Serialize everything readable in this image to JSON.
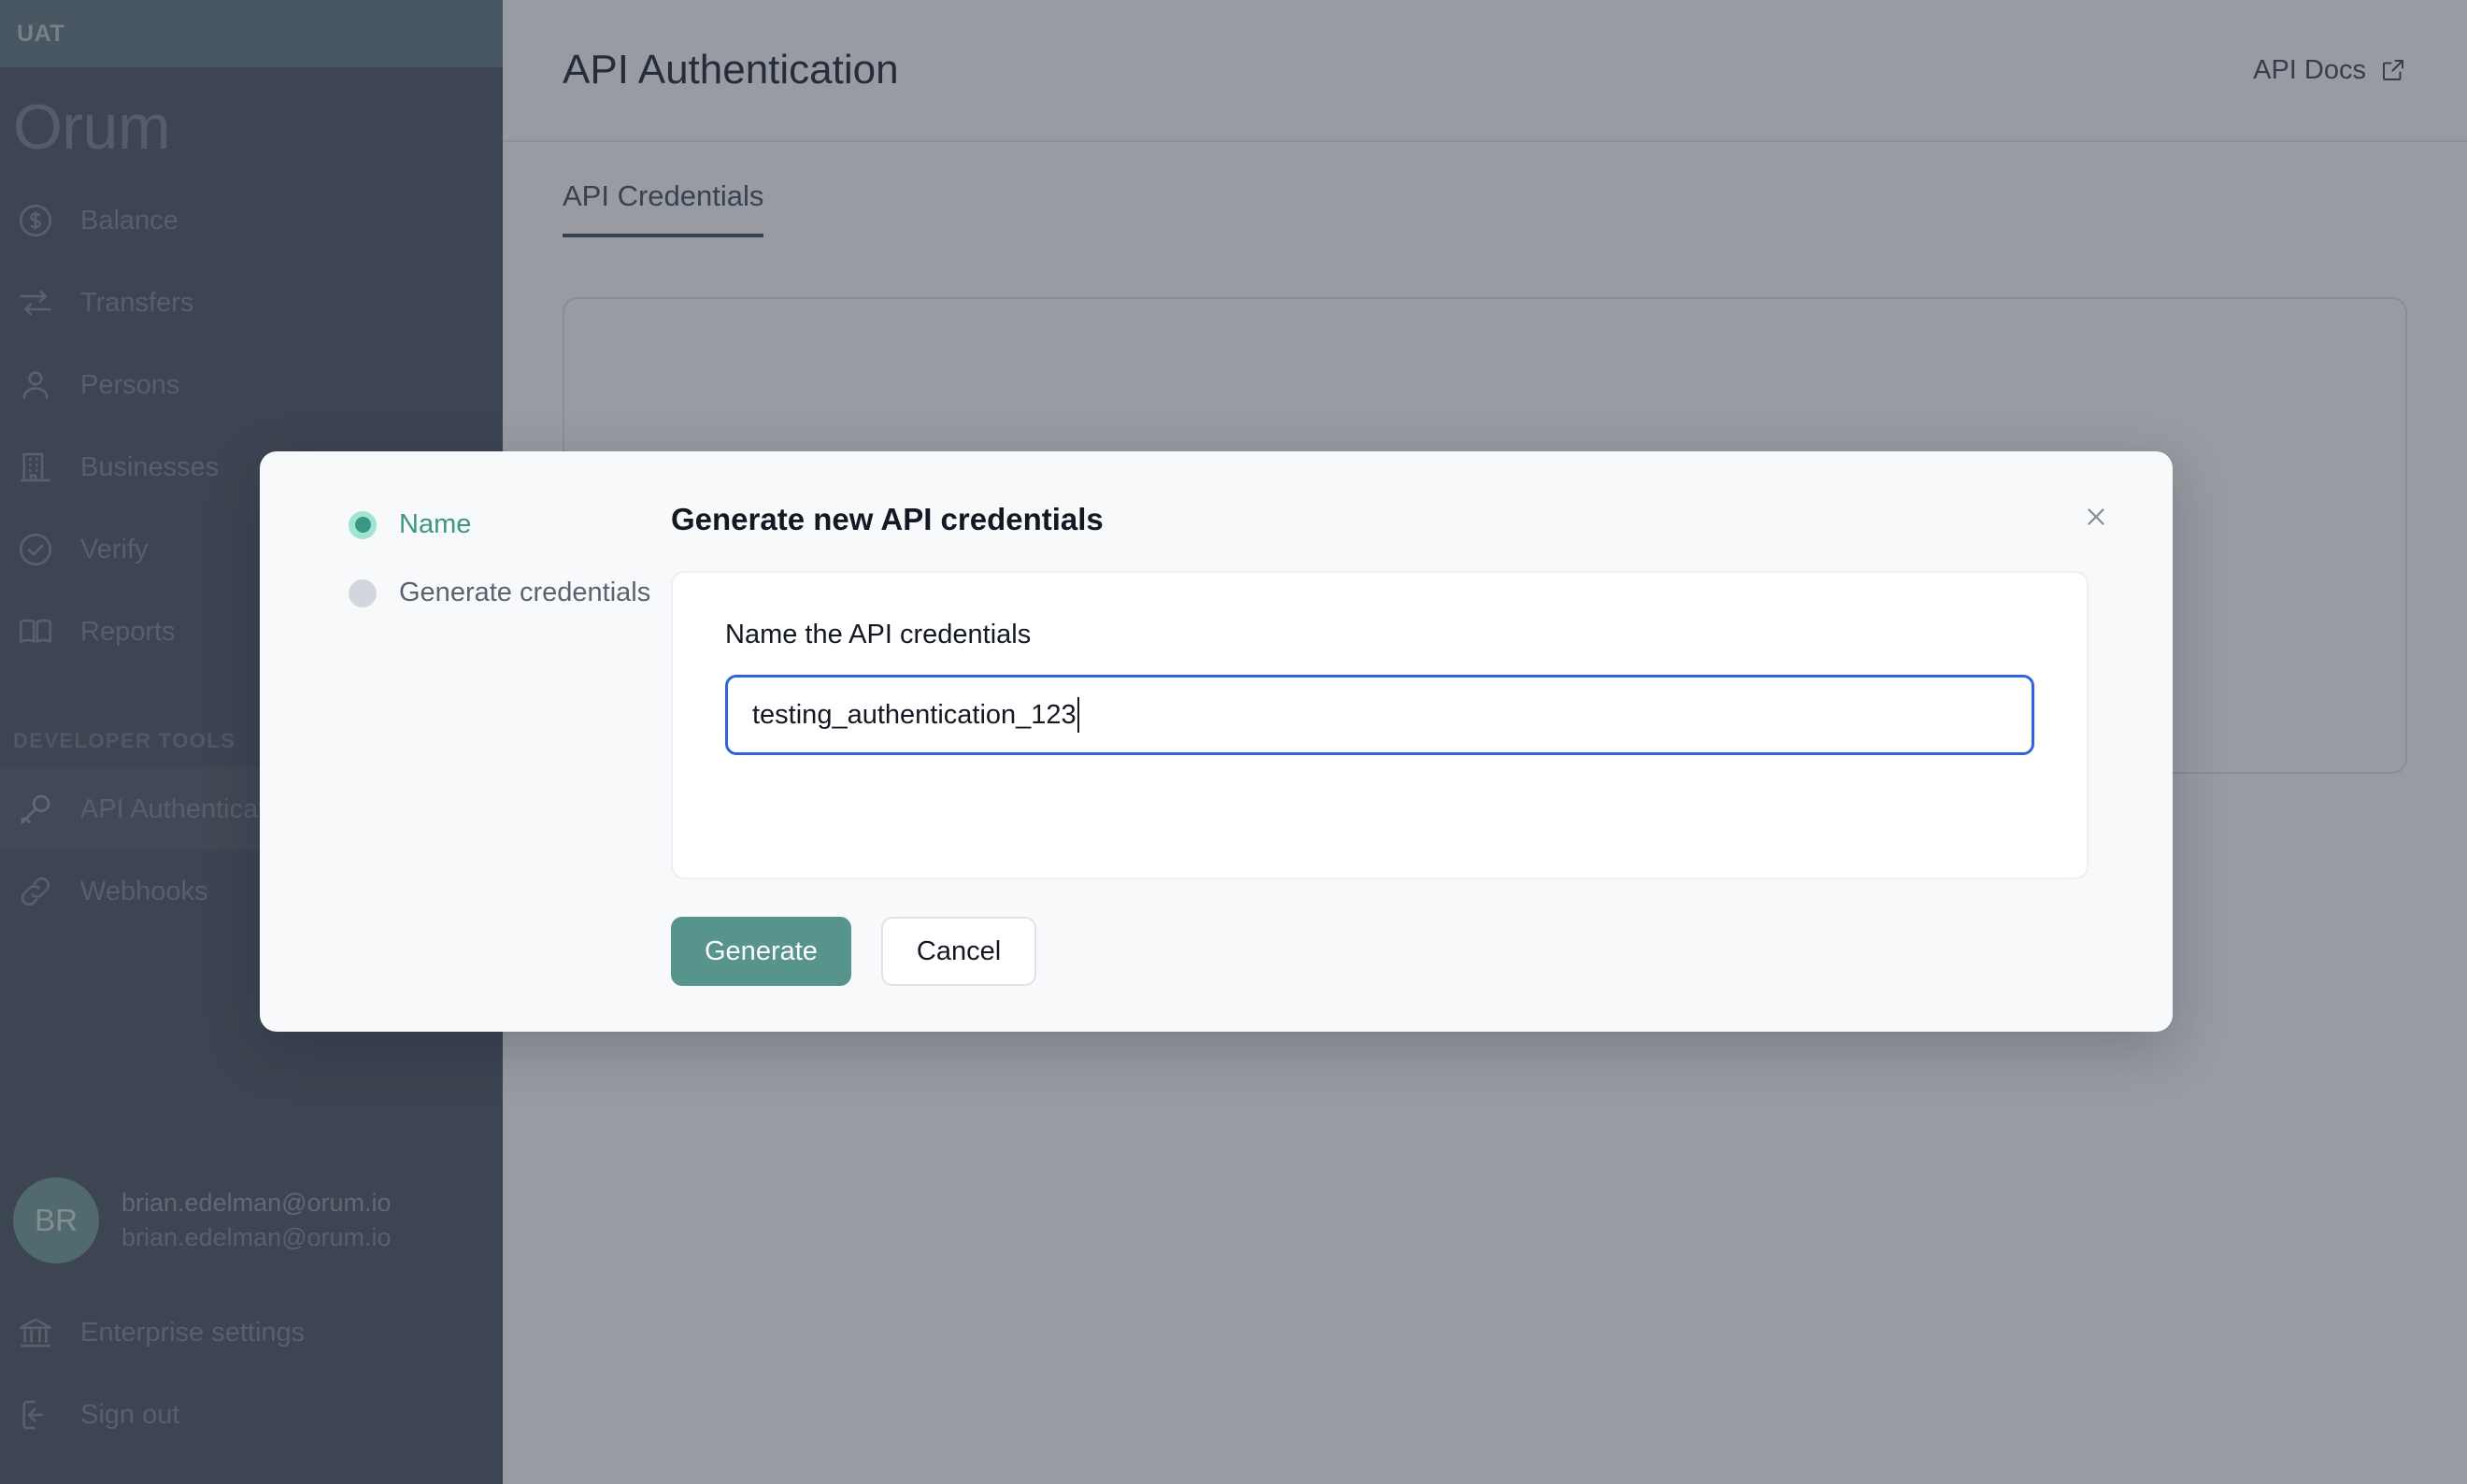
{
  "sidebar": {
    "env_badge": "UAT",
    "brand": "Orum",
    "nav": [
      {
        "label": "Balance",
        "icon": "dollar-circle-icon"
      },
      {
        "label": "Transfers",
        "icon": "transfers-arrows-icon"
      },
      {
        "label": "Persons",
        "icon": "person-icon"
      },
      {
        "label": "Businesses",
        "icon": "building-icon"
      },
      {
        "label": "Verify",
        "icon": "check-circle-icon"
      },
      {
        "label": "Reports",
        "icon": "book-icon"
      }
    ],
    "section_title": "DEVELOPER TOOLS",
    "dev_tools": [
      {
        "label": "API Authentication",
        "icon": "key-icon",
        "active": true
      },
      {
        "label": "Webhooks",
        "icon": "link-icon",
        "active": false
      }
    ],
    "user": {
      "initials": "BR",
      "name": "brian.edelman@orum.io",
      "email": "brian.edelman@orum.io"
    },
    "footer": [
      {
        "label": "Enterprise settings",
        "icon": "bank-icon"
      },
      {
        "label": "Sign out",
        "icon": "sign-out-icon"
      }
    ]
  },
  "header": {
    "title": "API Authentication",
    "api_docs_label": "API Docs",
    "api_docs_icon": "external-link-icon"
  },
  "tabs": [
    {
      "label": "API Credentials",
      "active": true
    }
  ],
  "modal": {
    "title": "Generate new API credentials",
    "close_icon": "close-icon",
    "steps": [
      {
        "label": "Name",
        "active": true
      },
      {
        "label": "Generate credentials",
        "active": false
      }
    ],
    "field_label": "Name the API credentials",
    "input_value": "testing_authentication_123",
    "input_placeholder": "",
    "primary_button": "Generate",
    "secondary_button": "Cancel"
  },
  "colors": {
    "sidebar_bg": "#58606b",
    "env_banner_bg": "#6d818a",
    "accent_teal": "#57958c",
    "step_active_teal": "#3a9685",
    "step_ring": "#9fe6d0",
    "input_focus_blue": "#2f64de",
    "avatar_bg": "#7ba49e",
    "modal_bg": "#f8f9fb"
  }
}
